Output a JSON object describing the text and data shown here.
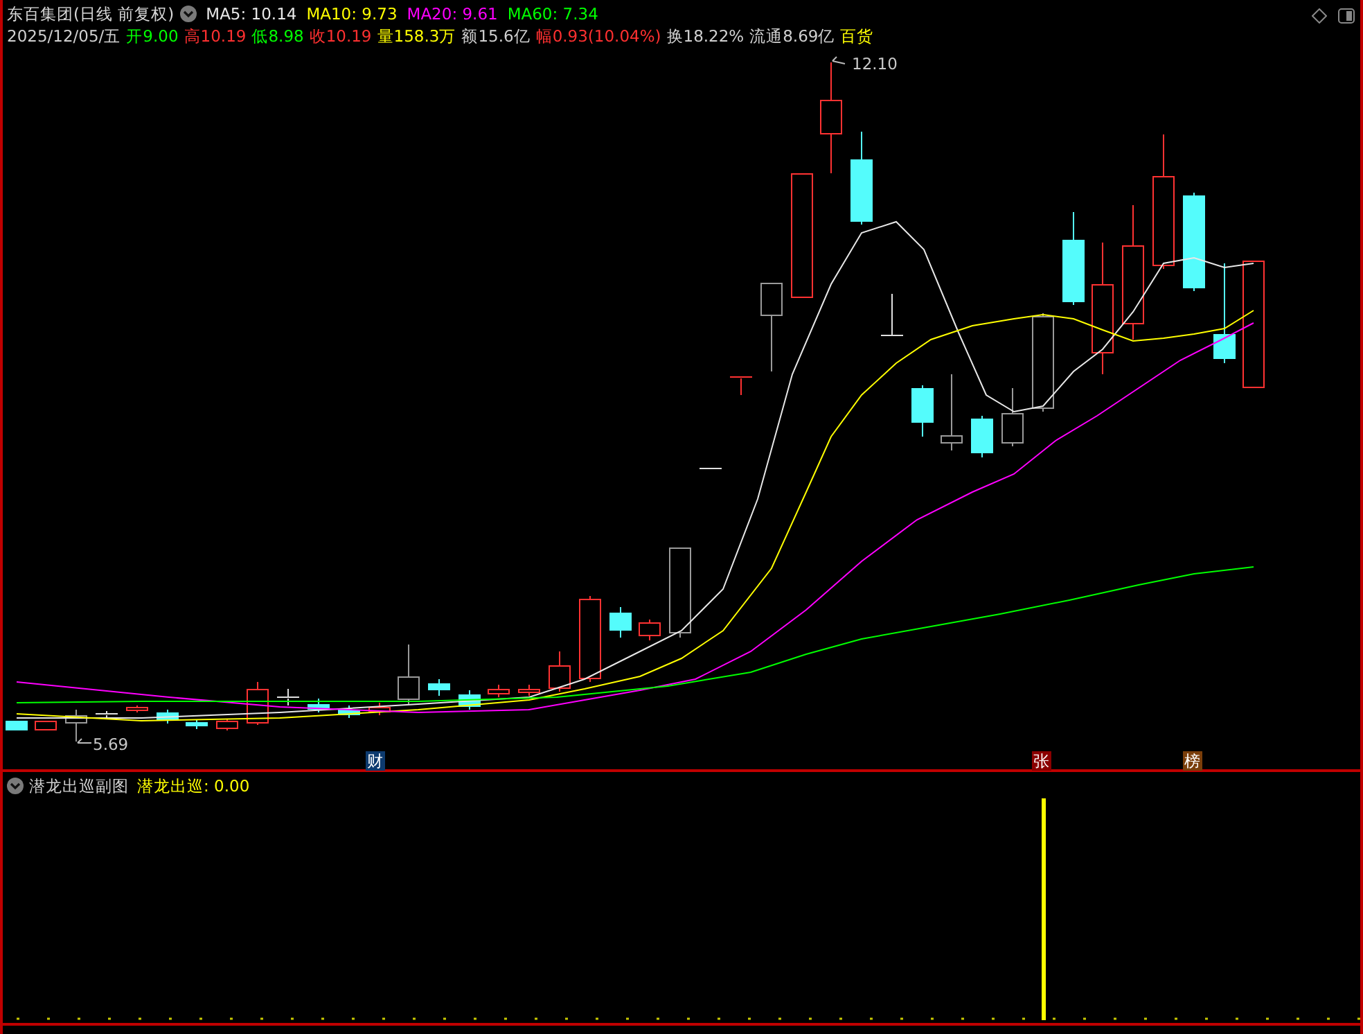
{
  "header": {
    "title": "东百集团(日线 前复权)",
    "ma": [
      {
        "label": "MA5: 10.14",
        "color": "#e8e8e8"
      },
      {
        "label": "MA10: 9.73",
        "color": "#ffff00"
      },
      {
        "label": "MA20: 9.61",
        "color": "#ff00ff"
      },
      {
        "label": "MA60: 7.34",
        "color": "#00ff00"
      }
    ],
    "quote": [
      {
        "text": "2025/12/05/五",
        "color": "#d0d0d0"
      },
      {
        "text": "开9.00",
        "color": "#00ff00"
      },
      {
        "text": "高10.19",
        "color": "#ff3030"
      },
      {
        "text": "低8.98",
        "color": "#00ff00"
      },
      {
        "text": "收10.19",
        "color": "#ff3030"
      },
      {
        "text": "量158.3万",
        "color": "#ffff00"
      },
      {
        "text": "额15.6亿",
        "color": "#d0d0d0"
      },
      {
        "text": "幅0.93(10.04%)",
        "color": "#ff3030"
      },
      {
        "text": "换18.22%",
        "color": "#d0d0d0"
      },
      {
        "text": "流通8.69亿",
        "color": "#d0d0d0"
      },
      {
        "text": "百货",
        "color": "#ffff00"
      }
    ]
  },
  "price_marks": [
    {
      "text": "12.10"
    },
    {
      "text": "5.69"
    }
  ],
  "event_tags": [
    {
      "text": "财",
      "color": "#0d3a6e"
    },
    {
      "text": "张",
      "color": "#8b0000"
    },
    {
      "text": "榜",
      "color": "#7a3e0a"
    }
  ],
  "sub_chart": {
    "title": "潜龙出巡副图",
    "indicator": "潜龙出巡: 0.00"
  }
}
